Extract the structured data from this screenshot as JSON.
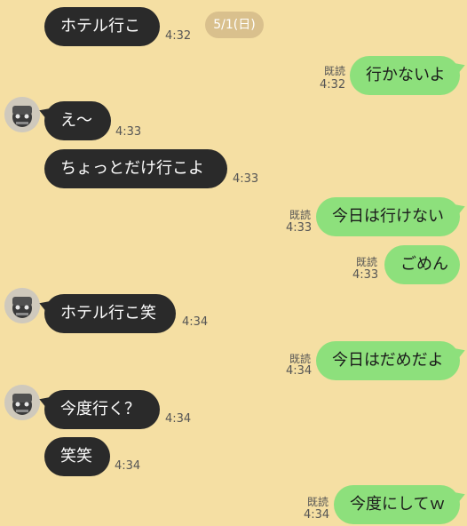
{
  "date_separator": "5/1(日)",
  "messages": [
    {
      "side": "left",
      "text": "ホテル行こ",
      "time": "4:32",
      "read": ""
    },
    {
      "side": "right",
      "text": "行かないよ",
      "time": "4:32",
      "read": "既読"
    },
    {
      "side": "left",
      "text": "え〜",
      "time": "4:33",
      "read": ""
    },
    {
      "side": "left",
      "text": "ちょっとだけ行こよ",
      "time": "4:33",
      "read": ""
    },
    {
      "side": "right",
      "text": "今日は行けない",
      "time": "4:33",
      "read": "既読"
    },
    {
      "side": "right",
      "text": "ごめん",
      "time": "4:33",
      "read": "既読"
    },
    {
      "side": "left",
      "text": "ホテル行こ笑",
      "time": "4:34",
      "read": ""
    },
    {
      "side": "right",
      "text": "今日はだめだよ",
      "time": "4:34",
      "read": "既読"
    },
    {
      "side": "left",
      "text": "今度行く？",
      "time": "4:34",
      "read": ""
    },
    {
      "side": "left",
      "text": "笑笑",
      "time": "4:34",
      "read": ""
    },
    {
      "side": "right",
      "text": "今度にしてｗ",
      "time": "4:34",
      "read": "既読"
    }
  ],
  "colors": {
    "background": "#f5dfa3",
    "left_bubble": "#2a2a2a",
    "right_bubble": "#8de07c",
    "date_pill": "#d9c08d"
  }
}
